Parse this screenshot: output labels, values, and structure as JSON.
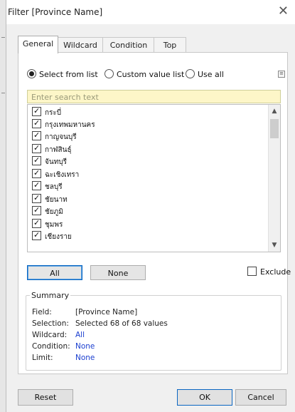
{
  "dialog": {
    "title": "Filter [Province Name]",
    "close_glyph": "✕"
  },
  "tabs": [
    {
      "label": "General",
      "active": true
    },
    {
      "label": "Wildcard",
      "active": false
    },
    {
      "label": "Condition",
      "active": false
    },
    {
      "label": "Top",
      "active": false
    }
  ],
  "mode": {
    "options": [
      {
        "label": "Select from list",
        "selected": true
      },
      {
        "label": "Custom value list",
        "selected": false
      },
      {
        "label": "Use all",
        "selected": false
      }
    ],
    "menu_icon": "list-menu-icon"
  },
  "search": {
    "placeholder": "Enter search text"
  },
  "list": {
    "items": [
      {
        "label": "กระบี่",
        "checked": true
      },
      {
        "label": "กรุงเทพมหานคร",
        "checked": true
      },
      {
        "label": "กาญจนบุรี",
        "checked": true
      },
      {
        "label": "กาฬสินธุ์",
        "checked": true
      },
      {
        "label": "จันทบุรี",
        "checked": true
      },
      {
        "label": "ฉะเชิงเทรา",
        "checked": true
      },
      {
        "label": "ชลบุรี",
        "checked": true
      },
      {
        "label": "ชัยนาท",
        "checked": true
      },
      {
        "label": "ชัยภูมิ",
        "checked": true
      },
      {
        "label": "ชุมพร",
        "checked": true
      },
      {
        "label": "เชียงราย",
        "checked": true
      }
    ],
    "scroll_up_glyph": "▲",
    "scroll_down_glyph": "▼"
  },
  "buttons": {
    "all": "All",
    "none": "None",
    "exclude": "Exclude"
  },
  "summary": {
    "legend": "Summary",
    "rows": [
      {
        "key": "Field:",
        "value": "[Province Name]",
        "highlight": false
      },
      {
        "key": "Selection:",
        "value": "Selected 68 of 68 values",
        "highlight": false
      },
      {
        "key": "Wildcard:",
        "value": "All",
        "highlight": true
      },
      {
        "key": "Condition:",
        "value": "None",
        "highlight": true
      },
      {
        "key": "Limit:",
        "value": "None",
        "highlight": true
      }
    ]
  },
  "footer": {
    "reset": "Reset",
    "ok": "OK",
    "cancel": "Cancel"
  },
  "colors": {
    "accent": "#0a66c2",
    "summary_link": "#1a3ecf",
    "search_bg": "#fdf6c8"
  }
}
